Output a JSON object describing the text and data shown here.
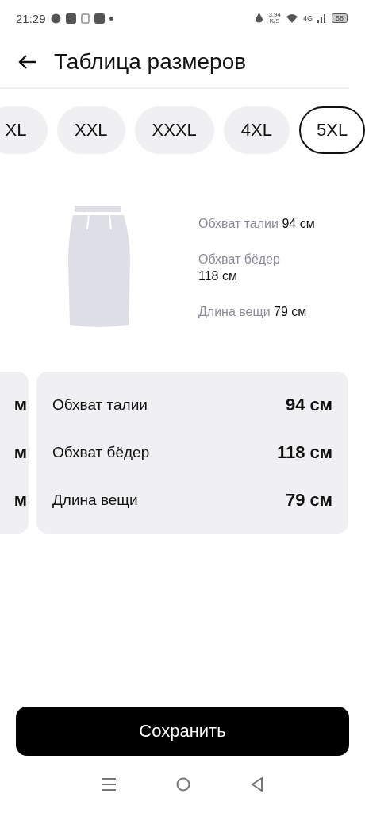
{
  "status_bar": {
    "time": "21:29",
    "speed": "3,94",
    "speed_unit": "K/S",
    "network": "4G",
    "battery": "58"
  },
  "header": {
    "title": "Таблица размеров"
  },
  "sizes": [
    {
      "label": "XL",
      "selected": false
    },
    {
      "label": "XXL",
      "selected": false
    },
    {
      "label": "XXXL",
      "selected": false
    },
    {
      "label": "4XL",
      "selected": false
    },
    {
      "label": "5XL",
      "selected": true
    }
  ],
  "illustration": {
    "measurements": [
      {
        "label": "Обхват талии",
        "value": "94 см",
        "wrap": false
      },
      {
        "label": "Обхват бёдер",
        "value": "118 см",
        "wrap": true
      },
      {
        "label": "Длина вещи",
        "value": "79 см",
        "wrap": false
      }
    ]
  },
  "previous_card": {
    "values": [
      "м",
      "м",
      "м"
    ]
  },
  "card": {
    "rows": [
      {
        "label": "Обхват талии",
        "value": "94 см"
      },
      {
        "label": "Обхват бёдер",
        "value": "118 см"
      },
      {
        "label": "Длина вещи",
        "value": "79 см"
      }
    ]
  },
  "save_button": {
    "label": "Сохранить"
  }
}
